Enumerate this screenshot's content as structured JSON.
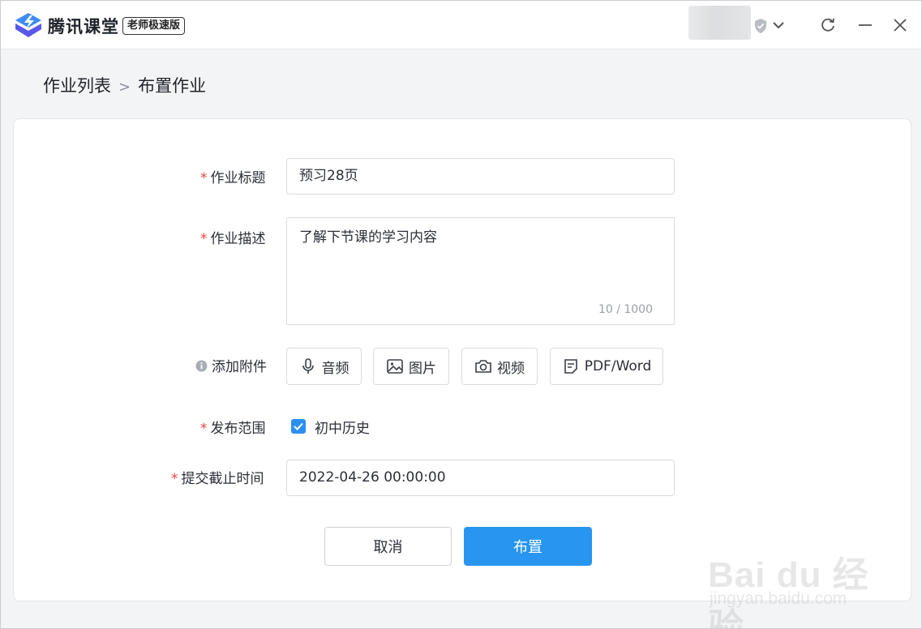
{
  "window": {
    "app_title": "腾讯课堂",
    "edition_badge": "老师极速版"
  },
  "breadcrumb": {
    "parent": "作业列表",
    "separator": ">",
    "current": "布置作业"
  },
  "form": {
    "title_field": {
      "required_mark": "*",
      "label": "作业标题",
      "value": "预习28页"
    },
    "description_field": {
      "required_mark": "*",
      "label": "作业描述",
      "value": "了解下节课的学习内容",
      "counter": "10 / 1000"
    },
    "attachments": {
      "label": "添加附件",
      "buttons": [
        {
          "icon": "microphone-icon",
          "label": "音频"
        },
        {
          "icon": "image-icon",
          "label": "图片"
        },
        {
          "icon": "camera-icon",
          "label": "视频"
        },
        {
          "icon": "document-icon",
          "label": "PDF/Word"
        }
      ]
    },
    "scope_field": {
      "required_mark": "*",
      "label": "发布范围",
      "option_label": "初中历史",
      "checked": true
    },
    "deadline_field": {
      "required_mark": "*",
      "label": "提交截止时间",
      "value": "2022-04-26 00:00:00"
    },
    "actions": {
      "cancel_label": "取消",
      "submit_label": "布置"
    }
  },
  "watermark": {
    "main": "Bai du 经验",
    "sub": "jingyan.baidu.com"
  },
  "colors": {
    "accent": "#2896f0",
    "required": "#e8453c",
    "checkbox": "#2b8ff0"
  }
}
